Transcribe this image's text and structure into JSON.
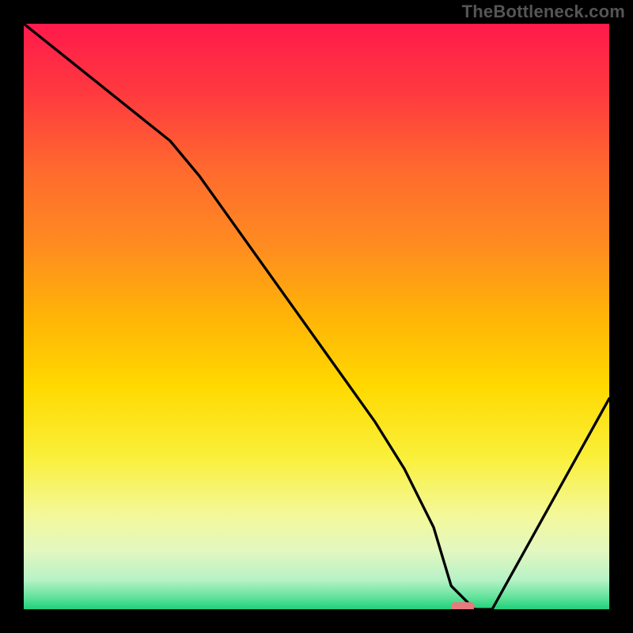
{
  "watermark": "TheBottleneck.com",
  "chart_data": {
    "type": "line",
    "title": "",
    "xlabel": "",
    "ylabel": "",
    "xlim": [
      0,
      100
    ],
    "ylim": [
      0,
      100
    ],
    "x": [
      0,
      5,
      10,
      15,
      20,
      25,
      30,
      35,
      40,
      45,
      50,
      55,
      60,
      65,
      70,
      73,
      77,
      80,
      85,
      90,
      95,
      100
    ],
    "values": [
      100,
      96,
      92,
      88,
      84,
      80,
      74,
      67,
      60,
      53,
      46,
      39,
      32,
      24,
      14,
      4,
      0,
      0,
      9,
      18,
      27,
      36
    ],
    "marker": {
      "x_start": 73,
      "x_end": 77,
      "y": 0.5,
      "color": "#e77a7d"
    },
    "gradient_stops": [
      {
        "offset": 0.0,
        "color": "#ff1a4b"
      },
      {
        "offset": 0.12,
        "color": "#ff3a3f"
      },
      {
        "offset": 0.25,
        "color": "#ff6a2e"
      },
      {
        "offset": 0.38,
        "color": "#ff8c20"
      },
      {
        "offset": 0.5,
        "color": "#ffb407"
      },
      {
        "offset": 0.62,
        "color": "#ffd900"
      },
      {
        "offset": 0.74,
        "color": "#faf03a"
      },
      {
        "offset": 0.84,
        "color": "#f3f89a"
      },
      {
        "offset": 0.9,
        "color": "#e3f7c0"
      },
      {
        "offset": 0.95,
        "color": "#b7f2c6"
      },
      {
        "offset": 0.98,
        "color": "#5fe29a"
      },
      {
        "offset": 1.0,
        "color": "#1fd07a"
      }
    ]
  }
}
